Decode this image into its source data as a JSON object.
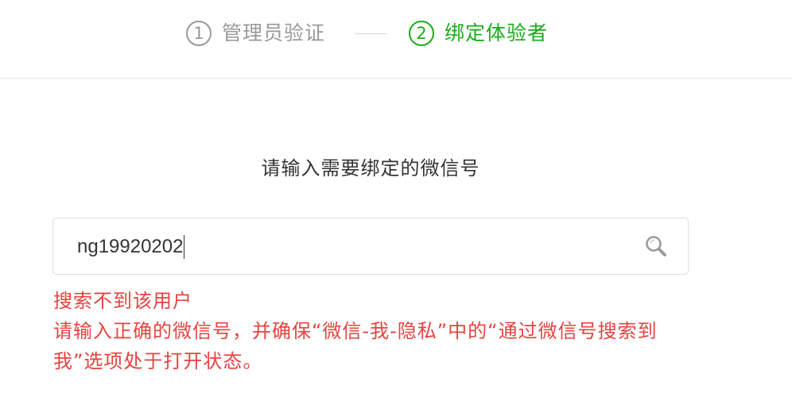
{
  "steps": [
    {
      "number": "1",
      "label": "管理员验证",
      "state": "done"
    },
    {
      "number": "2",
      "label": "绑定体验者",
      "state": "active"
    }
  ],
  "colors": {
    "active": "#1aad19",
    "inactive": "#999999",
    "error": "#e64340"
  },
  "prompt": "请输入需要绑定的微信号",
  "search": {
    "value": "ng19920202",
    "icon": "search-icon"
  },
  "error": {
    "title": "搜索不到该用户",
    "detail": "请输入正确的微信号，并确保“微信-我-隐私”中的“通过微信号搜索到我”选项处于打开状态。"
  }
}
